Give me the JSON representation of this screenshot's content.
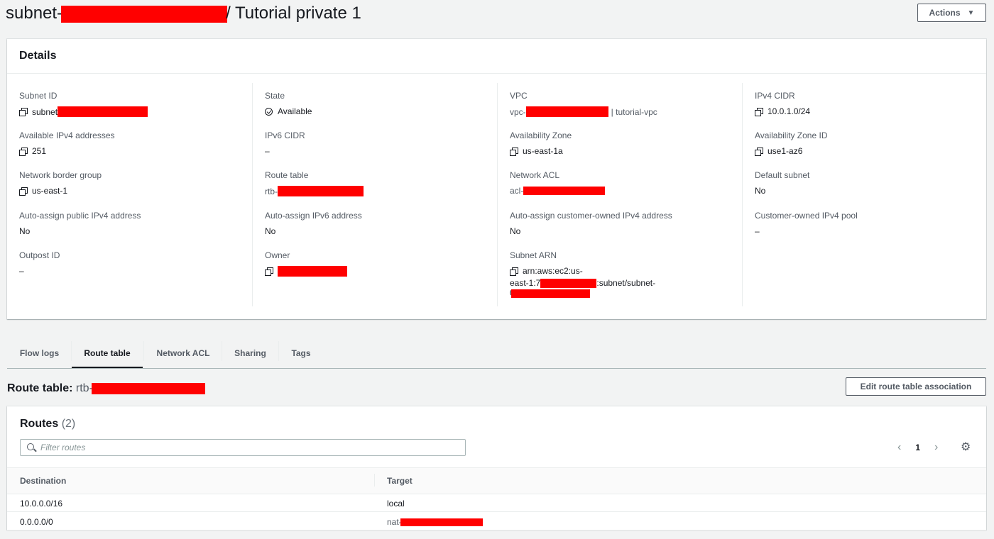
{
  "header": {
    "title_prefix": "subnet-",
    "title_suffix": "/ Tutorial private 1",
    "actions_label": "Actions"
  },
  "details": {
    "heading": "Details",
    "subnet_id": {
      "label": "Subnet ID",
      "value": "subnet"
    },
    "available_ipv4": {
      "label": "Available IPv4 addresses",
      "value": "251"
    },
    "network_border_group": {
      "label": "Network border group",
      "value": "us-east-1"
    },
    "auto_assign_public_ipv4": {
      "label": "Auto-assign public IPv4 address",
      "value": "No"
    },
    "outpost_id": {
      "label": "Outpost ID",
      "value": "–"
    },
    "state": {
      "label": "State",
      "value": "Available"
    },
    "ipv6_cidr": {
      "label": "IPv6 CIDR",
      "value": "–"
    },
    "route_table": {
      "label": "Route table",
      "value": "rtb-"
    },
    "auto_assign_ipv6": {
      "label": "Auto-assign IPv6 address",
      "value": "No"
    },
    "owner": {
      "label": "Owner",
      "value": ""
    },
    "vpc": {
      "label": "VPC",
      "value_prefix": "vpc-",
      "value_suffix": "| tutorial-vpc"
    },
    "availability_zone": {
      "label": "Availability Zone",
      "value": "us-east-1a"
    },
    "network_acl": {
      "label": "Network ACL",
      "value": "acl-"
    },
    "auto_assign_customer_owned": {
      "label": "Auto-assign customer-owned IPv4 address",
      "value": "No"
    },
    "subnet_arn": {
      "label": "Subnet ARN",
      "line1": "arn:aws:ec2:us-",
      "line2_prefix": "east-1:7",
      "line2_suffix": ":subnet/subnet-",
      "line3_prefix": "0"
    },
    "ipv4_cidr": {
      "label": "IPv4 CIDR",
      "value": "10.0.1.0/24"
    },
    "availability_zone_id": {
      "label": "Availability Zone ID",
      "value": "use1-az6"
    },
    "default_subnet": {
      "label": "Default subnet",
      "value": "No"
    },
    "customer_owned_pool": {
      "label": "Customer-owned IPv4 pool",
      "value": "–"
    }
  },
  "tabs": [
    {
      "label": "Flow logs"
    },
    {
      "label": "Route table"
    },
    {
      "label": "Network ACL"
    },
    {
      "label": "Sharing"
    },
    {
      "label": "Tags"
    }
  ],
  "active_tab": "Route table",
  "route_table_section": {
    "title_label": "Route table:",
    "title_value": "rtb-",
    "edit_button_label": "Edit route table association"
  },
  "routes": {
    "heading": "Routes",
    "count": "(2)",
    "filter_placeholder": "Filter routes",
    "page": "1",
    "columns": [
      "Destination",
      "Target"
    ],
    "rows": [
      {
        "destination": "10.0.0.0/16",
        "target": "local"
      },
      {
        "destination": "0.0.0.0/0",
        "target": "nat-"
      }
    ]
  },
  "colors": {
    "background": "#f2f3f3",
    "redaction": "#ff0000",
    "text": "#16191f",
    "muted": "#545b64"
  }
}
